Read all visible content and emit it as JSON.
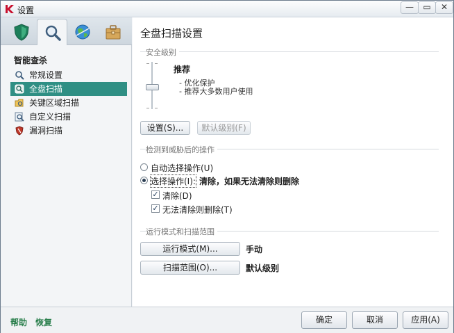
{
  "window": {
    "title": "设置"
  },
  "sidebar": {
    "section_head": "智能查杀",
    "items": [
      {
        "label": "常规设置",
        "icon": "magnifier-icon"
      },
      {
        "label": "全盘扫描",
        "icon": "disk-scan-icon",
        "selected": true
      },
      {
        "label": "关键区域扫描",
        "icon": "folder-scan-icon"
      },
      {
        "label": "自定义扫描",
        "icon": "custom-scan-icon"
      },
      {
        "label": "漏洞扫描",
        "icon": "vulnerability-icon"
      }
    ],
    "help": "帮助",
    "restore": "恢复"
  },
  "main": {
    "title": "全盘扫描设置",
    "security_group": "安全级别",
    "level_name": "推荐",
    "level_desc": [
      "- 优化保护",
      "- 推荐大多数用户使用"
    ],
    "settings_button": "设置(S)...",
    "default_level_button": "默认级别(F)",
    "threat_group": "检测到威胁后的操作",
    "auto_select": "自动选择操作(U)",
    "choose_action": "选择操作(I):",
    "choose_action_value": "清除，如果无法清除则删除",
    "clean": "清除(D)",
    "delete_if_fail": "无法清除则删除(T)",
    "run_group": "运行模式和扫描范围",
    "run_mode_button": "运行模式(M)...",
    "run_mode_value": "手动",
    "scan_scope_button": "扫描范围(O)...",
    "scan_scope_value": "默认级别"
  },
  "footer": {
    "ok": "确定",
    "cancel": "取消",
    "apply": "应用(A)"
  }
}
